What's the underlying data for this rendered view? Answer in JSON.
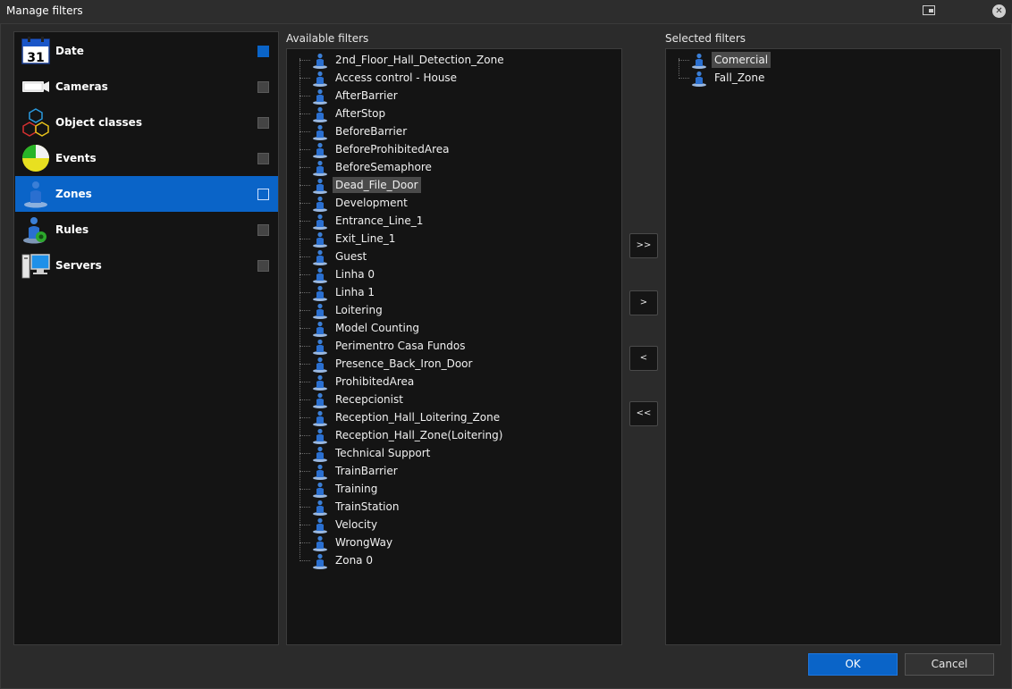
{
  "window": {
    "title": "Manage filters"
  },
  "categories": [
    {
      "label": "Date",
      "icon": "calendar-icon",
      "day": "31",
      "checked": true,
      "selected": false
    },
    {
      "label": "Cameras",
      "icon": "camera-icon",
      "checked": false,
      "selected": false
    },
    {
      "label": "Object classes",
      "icon": "cubes-icon",
      "checked": false,
      "selected": false
    },
    {
      "label": "Events",
      "icon": "pie-chart-icon",
      "checked": false,
      "selected": false
    },
    {
      "label": "Zones",
      "icon": "zone-person-icon",
      "checked": false,
      "selected": true
    },
    {
      "label": "Rules",
      "icon": "rule-person-icon",
      "checked": false,
      "selected": false
    },
    {
      "label": "Servers",
      "icon": "server-monitor-icon",
      "checked": false,
      "selected": false
    }
  ],
  "available": {
    "label": "Available filters",
    "items": [
      "2nd_Floor_Hall_Detection_Zone",
      "Access control - House",
      "AfterBarrier",
      "AfterStop",
      "BeforeBarrier",
      "BeforeProhibitedArea",
      "BeforeSemaphore",
      "Dead_File_Door",
      "Development",
      "Entrance_Line_1",
      "Exit_Line_1",
      "Guest",
      "Linha 0",
      "Linha 1",
      "Loitering",
      "Model Counting",
      "Perimentro Casa Fundos",
      "Presence_Back_Iron_Door",
      "ProhibitedArea",
      "Recepcionist",
      "Reception_Hall_Loitering_Zone",
      "Reception_Hall_Zone(Loitering)",
      "Technical Support",
      "TrainBarrier",
      "Training",
      "TrainStation",
      "Velocity",
      "WrongWay",
      "Zona 0"
    ],
    "selected_item": "Dead_File_Door"
  },
  "selected": {
    "label": "Selected filters",
    "items": [
      "Comercial",
      "Fall_Zone"
    ],
    "selected_item": "Comercial"
  },
  "move_buttons": {
    "add_all": ">>",
    "add": ">",
    "remove": "<",
    "remove_all": "<<"
  },
  "footer": {
    "ok": "OK",
    "cancel": "Cancel"
  },
  "colors": {
    "accent": "#0a64c8",
    "background": "#2b2b2b",
    "panel": "#141414"
  }
}
